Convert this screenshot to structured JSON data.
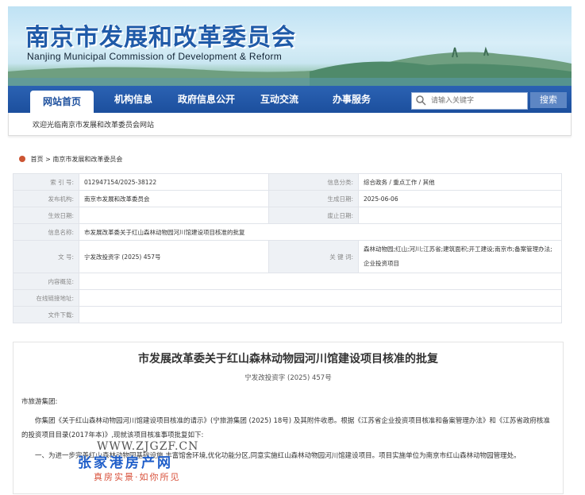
{
  "header": {
    "title": "南京市发展和改革委员会",
    "subtitle": "Nanjing Municipal Commission of Development & Reform"
  },
  "nav": {
    "items": [
      "网站首页",
      "机构信息",
      "政府信息公开",
      "互动交流",
      "办事服务"
    ],
    "active_index": 0,
    "search_placeholder": "请输入关键字",
    "search_button": "搜索"
  },
  "welcome": "欢迎光临南京市发展和改革委员会网站",
  "breadcrumb": [
    "首页",
    "南京市发展和改革委员会"
  ],
  "meta": {
    "index_label": "索 引 号:",
    "index_value": "012947154/2025-38122",
    "category_label": "信息分类:",
    "category_value": "综合政务 / 重点工作 / 其他",
    "publisher_label": "发布机构:",
    "publisher_value": "南京市发展和改革委员会",
    "created_label": "生成日期:",
    "created_value": "2025-06-06",
    "effective_label": "生效日期:",
    "effective_value": "",
    "abolish_label": "废止日期:",
    "abolish_value": "",
    "name_label": "信息名称:",
    "name_value": "市发展改革委关于红山森林动物园河川馆建设项目核准的批复",
    "docno_label": "文 号:",
    "docno_value": "宁发改投资字 (2025) 457号",
    "keywords_label": "关 键 词:",
    "keywords_value": "森林动物园;红山;河川;江苏省;建筑面积;开工建设;南京市;备案管理办法;企业投资项目",
    "summary_label": "内容概览:",
    "summary_value": "",
    "link_label": "在线链接地址:",
    "link_value": "",
    "download_label": "文件下载:",
    "download_value": ""
  },
  "doc": {
    "title": "市发展改革委关于红山森林动物园河川馆建设项目核准的批复",
    "number": "宁发改投资字 (2025) 457号",
    "addressee": "市旅游集团:",
    "para1": "你集团《关于红山森林动物园河川馆建设项目核准的请示》(宁旅游集团 (2025) 18号) 及其附件收悉。根据《江苏省企业投资项目核准和备案管理办法》和《江苏省政府核准的投资项目目录(2017年本)》,现就该项目核准事项批复如下:",
    "para2": "一、为进一步完善红山森林动物园基础设施,丰富馆舍环境,优化功能分区,同意实施红山森林动物园河川馆建设项目。项目实施单位为南京市红山森林动物园管理处。"
  },
  "watermark": {
    "url": "WWW.ZJGZF.CN",
    "name": "张家港房产网",
    "slogan": "真房实景·如你所见"
  },
  "colors": {
    "brand_blue": "#1c4f9d",
    "label_bg": "#eef1f5"
  }
}
